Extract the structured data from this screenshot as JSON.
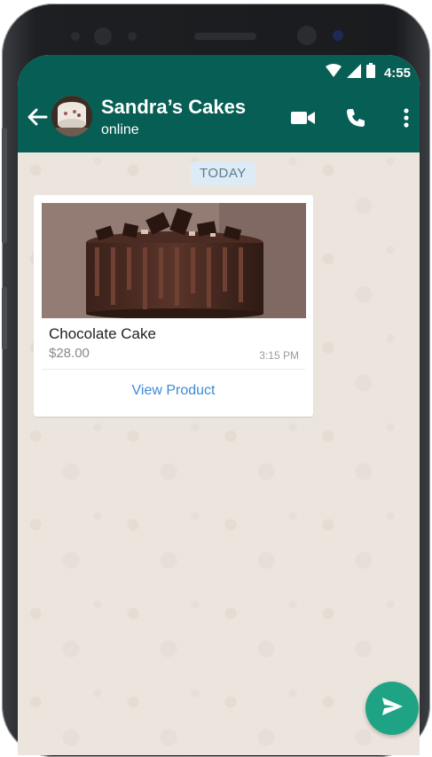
{
  "status_bar": {
    "time": "4:55",
    "icons": [
      "wifi-icon",
      "signal-icon",
      "battery-icon"
    ]
  },
  "header": {
    "title": "Sandra’s Cakes",
    "subtitle": "online",
    "actions": [
      "video-call-icon",
      "phone-icon",
      "more-vert-icon"
    ]
  },
  "chat": {
    "day_label": "TODAY",
    "product_message": {
      "name": "Chocolate Cake",
      "price": "$28.00",
      "time": "3:15 PM",
      "action_label": "View Product"
    }
  },
  "composer": {
    "send_icon": "send-icon"
  },
  "colors": {
    "header": "#075e54",
    "accent": "#1fa385",
    "link": "#3e8ad6",
    "chat_background": "#ece5dd"
  }
}
